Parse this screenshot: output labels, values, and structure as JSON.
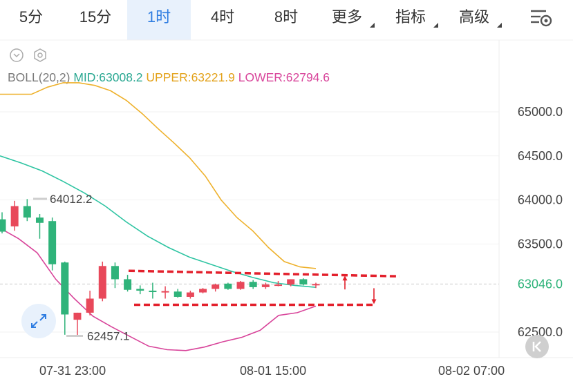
{
  "tabs": [
    {
      "label": "5分",
      "active": false,
      "dropdown": false
    },
    {
      "label": "15分",
      "active": false,
      "dropdown": false
    },
    {
      "label": "1时",
      "active": true,
      "dropdown": false
    },
    {
      "label": "4时",
      "active": false,
      "dropdown": false
    },
    {
      "label": "8时",
      "active": false,
      "dropdown": false
    },
    {
      "label": "更多",
      "active": false,
      "dropdown": true
    },
    {
      "label": "指标",
      "active": false,
      "dropdown": true
    },
    {
      "label": "高级",
      "active": false,
      "dropdown": true
    }
  ],
  "toolbar_icons": [
    "chevron-down-icon",
    "hexagon-settings-icon",
    "chart-settings-icon"
  ],
  "legend": {
    "name": "BOLL(20,2)",
    "mid": "MID:63008.2",
    "upper": "UPPER:63221.9",
    "lower": "LOWER:62794.6"
  },
  "colors": {
    "up": "#e8485a",
    "down": "#2fb37a",
    "mid": "#2ec4a2",
    "upper": "#eeb12c",
    "lower": "#d8449a",
    "accent": "#2f7de1",
    "annotation": "#e3202c"
  },
  "chart_data": {
    "type": "candlestick",
    "indicator": "BOLL(20,2)",
    "y_axis": {
      "ticks": [
        "65000.0",
        "64500.0",
        "64000.0",
        "63500.0",
        "63046.0",
        "62500.0"
      ],
      "range": [
        62250,
        65400
      ],
      "current_price": 63046.0
    },
    "x_axis": {
      "ticks": [
        "07-31 23:00",
        "08-01 15:00",
        "08-02 07:00"
      ]
    },
    "annotations": {
      "high_marker": "64012.2",
      "low_marker": "62457.1"
    },
    "candles": [
      {
        "o": 63780,
        "h": 63860,
        "l": 63620,
        "c": 63640
      },
      {
        "o": 63700,
        "h": 63990,
        "l": 63650,
        "c": 63930
      },
      {
        "o": 63930,
        "h": 64010,
        "l": 63760,
        "c": 63800
      },
      {
        "o": 63800,
        "h": 63840,
        "l": 63560,
        "c": 63740
      },
      {
        "o": 63760,
        "h": 63800,
        "l": 63200,
        "c": 63270
      },
      {
        "o": 63290,
        "h": 63300,
        "l": 62470,
        "c": 62700
      },
      {
        "o": 62640,
        "h": 62720,
        "l": 62457,
        "c": 62720
      },
      {
        "o": 62720,
        "h": 62970,
        "l": 62690,
        "c": 62880
      },
      {
        "o": 62880,
        "h": 63300,
        "l": 62850,
        "c": 63250
      },
      {
        "o": 63250,
        "h": 63290,
        "l": 63000,
        "c": 63100
      },
      {
        "o": 63100,
        "h": 63150,
        "l": 62960,
        "c": 62980
      },
      {
        "o": 62990,
        "h": 63030,
        "l": 62930,
        "c": 62970
      },
      {
        "o": 62970,
        "h": 63060,
        "l": 62880,
        "c": 62960
      },
      {
        "o": 62960,
        "h": 63020,
        "l": 62880,
        "c": 62965
      },
      {
        "o": 62960,
        "h": 62990,
        "l": 62890,
        "c": 62900
      },
      {
        "o": 62900,
        "h": 62970,
        "l": 62880,
        "c": 62950
      },
      {
        "o": 62950,
        "h": 63000,
        "l": 62940,
        "c": 62990
      },
      {
        "o": 62990,
        "h": 63050,
        "l": 62960,
        "c": 63040
      },
      {
        "o": 63050,
        "h": 63060,
        "l": 62980,
        "c": 62990
      },
      {
        "o": 62990,
        "h": 63080,
        "l": 62980,
        "c": 63070
      },
      {
        "o": 63070,
        "h": 63090,
        "l": 62990,
        "c": 63010
      },
      {
        "o": 63010,
        "h": 63060,
        "l": 62990,
        "c": 63040
      },
      {
        "o": 63040,
        "h": 63080,
        "l": 63020,
        "c": 63040
      },
      {
        "o": 63040,
        "h": 63100,
        "l": 63020,
        "c": 63100
      },
      {
        "o": 63100,
        "h": 63110,
        "l": 63030,
        "c": 63040
      },
      {
        "o": 63040,
        "h": 63060,
        "l": 63000,
        "c": 63046
      }
    ],
    "series": [
      {
        "name": "UPPER",
        "values": [
          65200,
          65200,
          65200,
          65280,
          65330,
          65330,
          65300,
          65240,
          65130,
          64980,
          64810,
          64650,
          64480,
          64270,
          64000,
          63800,
          63650,
          63460,
          63300,
          63240,
          63222
        ]
      },
      {
        "name": "MID",
        "values": [
          64500,
          64420,
          64330,
          64210,
          64080,
          63930,
          63750,
          63590,
          63460,
          63350,
          63270,
          63190,
          63120,
          63060,
          63030,
          63008
        ]
      },
      {
        "name": "LOWER",
        "values": [
          63680,
          63560,
          63400,
          63100,
          62880,
          62680,
          62560,
          62450,
          62340,
          62300,
          62290,
          62330,
          62390,
          62440,
          62520,
          62690,
          62720,
          62795
        ]
      }
    ],
    "lines": {
      "resistance": 63180,
      "support": 62810
    }
  }
}
